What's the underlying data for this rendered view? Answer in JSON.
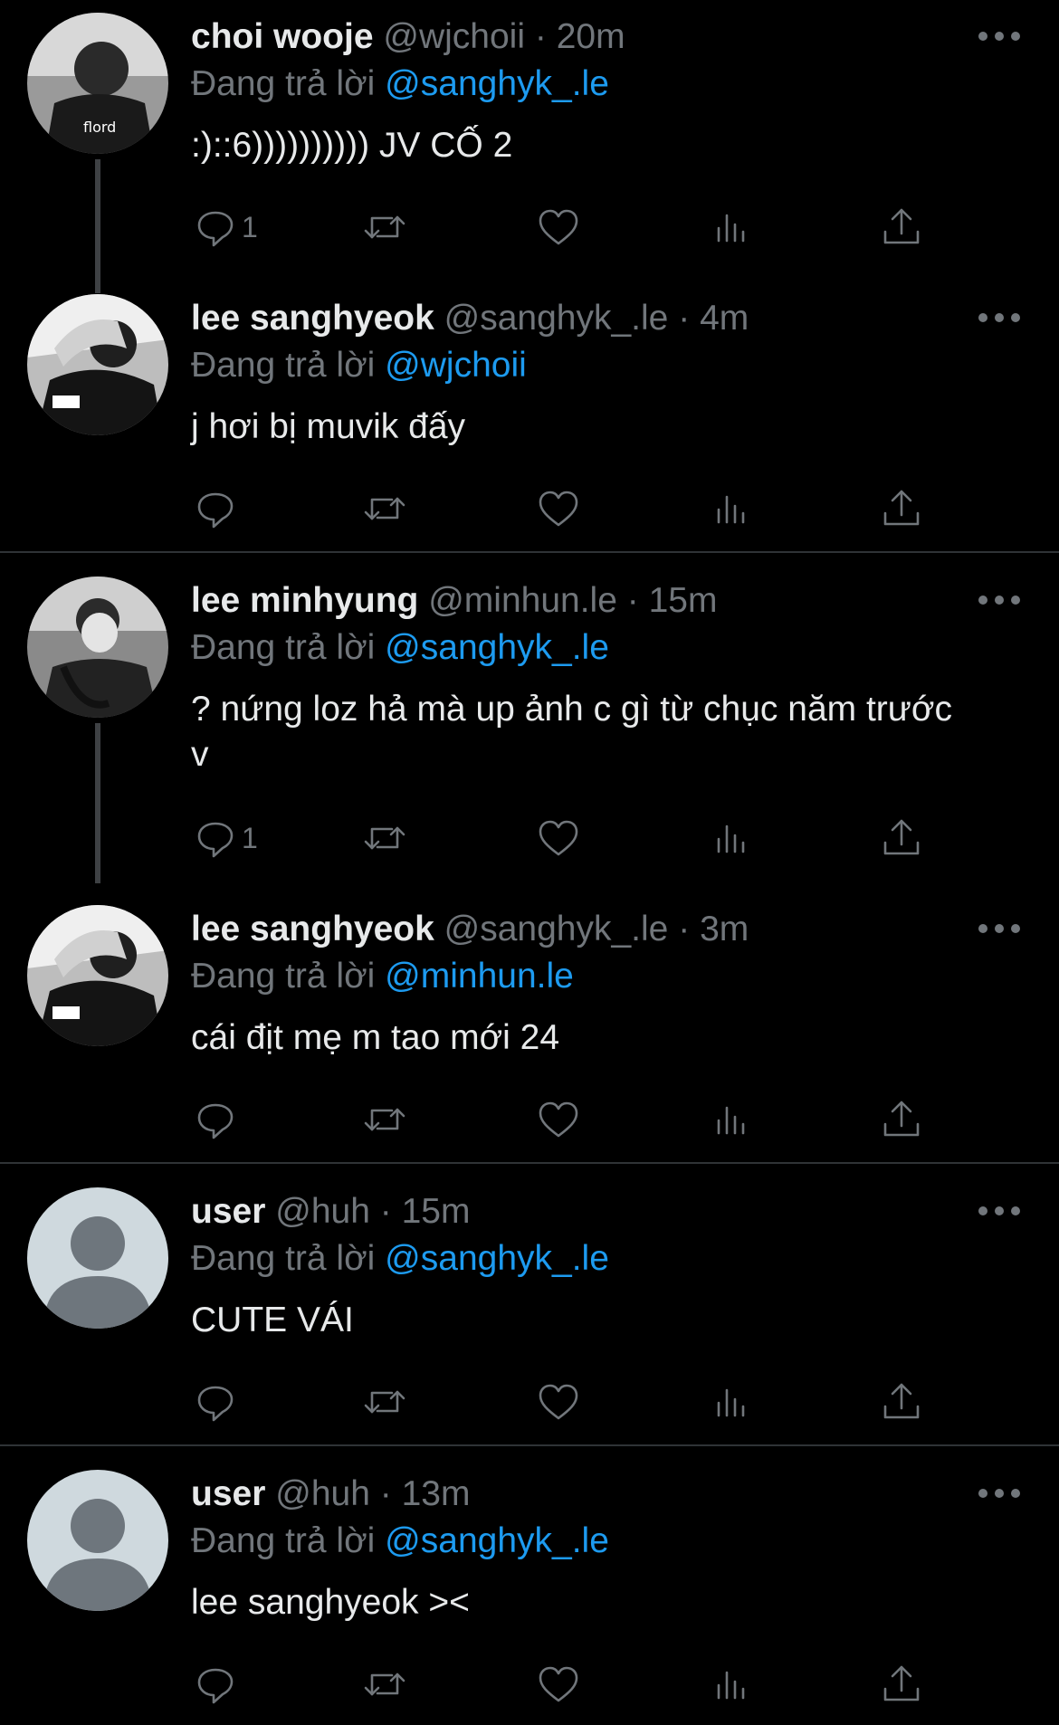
{
  "ui": {
    "reply_prefix": "Đang trả lời",
    "dot": "·",
    "colors": {
      "background": "#000000",
      "text": "#e7e9ea",
      "muted": "#71767b",
      "link": "#1d9bf0",
      "divider": "#2f3336"
    }
  },
  "tweets": [
    {
      "name": "choi wooje",
      "handle": "@wjchoii",
      "time": "20m",
      "reply_to": "@sanghyk_.le",
      "text": ":)::6)))))))))) JV CỐ 2",
      "reply_count": "1",
      "avatar": "photo-grayscale"
    },
    {
      "name": "lee sanghyeok",
      "handle": "@sanghyk_.le",
      "time": "4m",
      "reply_to": "@wjchoii",
      "text": "j hơi bị muvik đấy",
      "reply_count": "",
      "avatar": "photo-grayscale"
    },
    {
      "name": "lee minhyung",
      "handle": "@minhun.le",
      "time": "15m",
      "reply_to": "@sanghyk_.le",
      "text": "? nứng loz hả mà up ảnh c gì từ chục năm trước v",
      "reply_count": "1",
      "avatar": "photo-grayscale"
    },
    {
      "name": "lee sanghyeok",
      "handle": "@sanghyk_.le",
      "time": "3m",
      "reply_to": "@minhun.le",
      "text": "cái địt mẹ m tao mới 24",
      "reply_count": "",
      "avatar": "photo-grayscale"
    },
    {
      "name": "user",
      "handle": "@huh",
      "time": "15m",
      "reply_to": "@sanghyk_.le",
      "text": "CUTE VÁI",
      "reply_count": "",
      "avatar": "default-avatar"
    },
    {
      "name": "user",
      "handle": "@huh",
      "time": "13m",
      "reply_to": "@sanghyk_.le",
      "text": "lee sanghyeok ><",
      "reply_count": "",
      "avatar": "default-avatar"
    }
  ],
  "icons": [
    "reply-icon",
    "retweet-icon",
    "like-icon",
    "views-icon",
    "share-icon",
    "more-icon"
  ]
}
